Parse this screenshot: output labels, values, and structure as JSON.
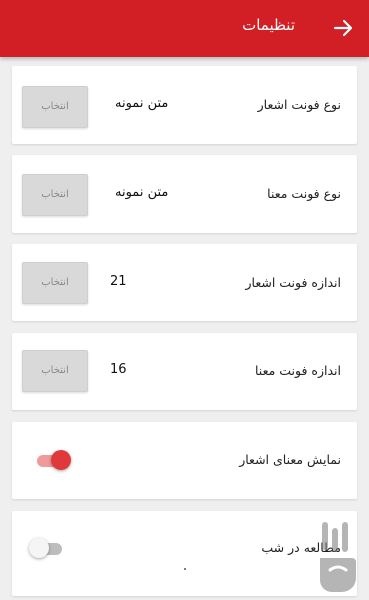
{
  "header": {
    "title": "تنظیمات",
    "back_icon": "arrow-right-icon",
    "background": "#d21f26"
  },
  "settings": [
    {
      "label": "نوع فونت اشعار",
      "value": "متن نمونه",
      "button_label": "انتخاب"
    },
    {
      "label": "نوع فونت معنا",
      "value": "متن نمونه",
      "button_label": "انتخاب"
    },
    {
      "label": "اندازه فونت اشعار",
      "value": "21",
      "button_label": "انتخاب"
    },
    {
      "label": "اندازه فونت معنا",
      "value": "16",
      "button_label": "انتخاب"
    }
  ],
  "toggles": [
    {
      "label": "نمایش معنای اشعار",
      "checked": true
    },
    {
      "label": "مطالعه در شب",
      "checked": false
    }
  ],
  "colors": {
    "accent": "#d21f26",
    "toggle_on": "#e0393c",
    "toggle_on_track": "#f09a9a"
  }
}
